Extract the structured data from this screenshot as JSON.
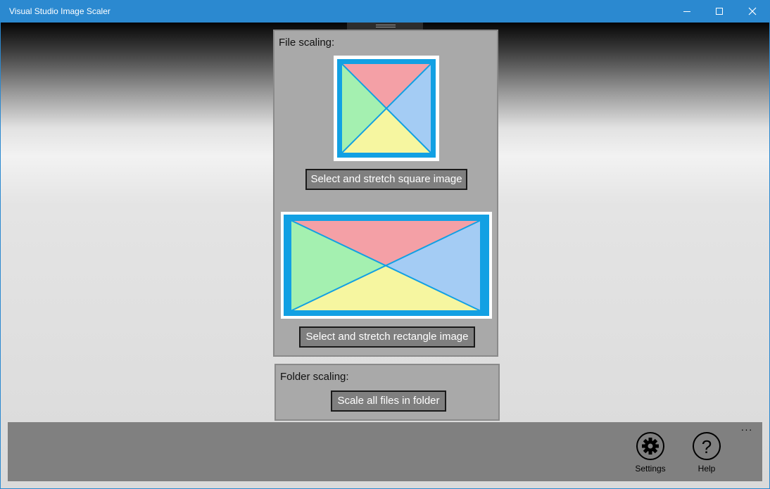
{
  "window": {
    "title": "Visual Studio Image Scaler",
    "titlebar_color": "#2b89d0",
    "controls": [
      "minimize-icon",
      "maximize-icon",
      "close-icon"
    ]
  },
  "file_scaling": {
    "label": "File scaling:",
    "square_button_label": "Select and stretch square image",
    "rect_button_label": "Select and stretch rectangle image",
    "preview_colors": {
      "border": "#12a0e3",
      "top": "#f4a0a6",
      "left": "#a4f0b0",
      "right": "#a4ccf4",
      "bottom": "#f6f6a0"
    }
  },
  "folder_scaling": {
    "label": "Folder scaling:",
    "button_label": "Scale all files in folder"
  },
  "command_bar": {
    "more_label": "···",
    "settings_label": "Settings",
    "help_label": "Help",
    "help_glyph": "?"
  }
}
